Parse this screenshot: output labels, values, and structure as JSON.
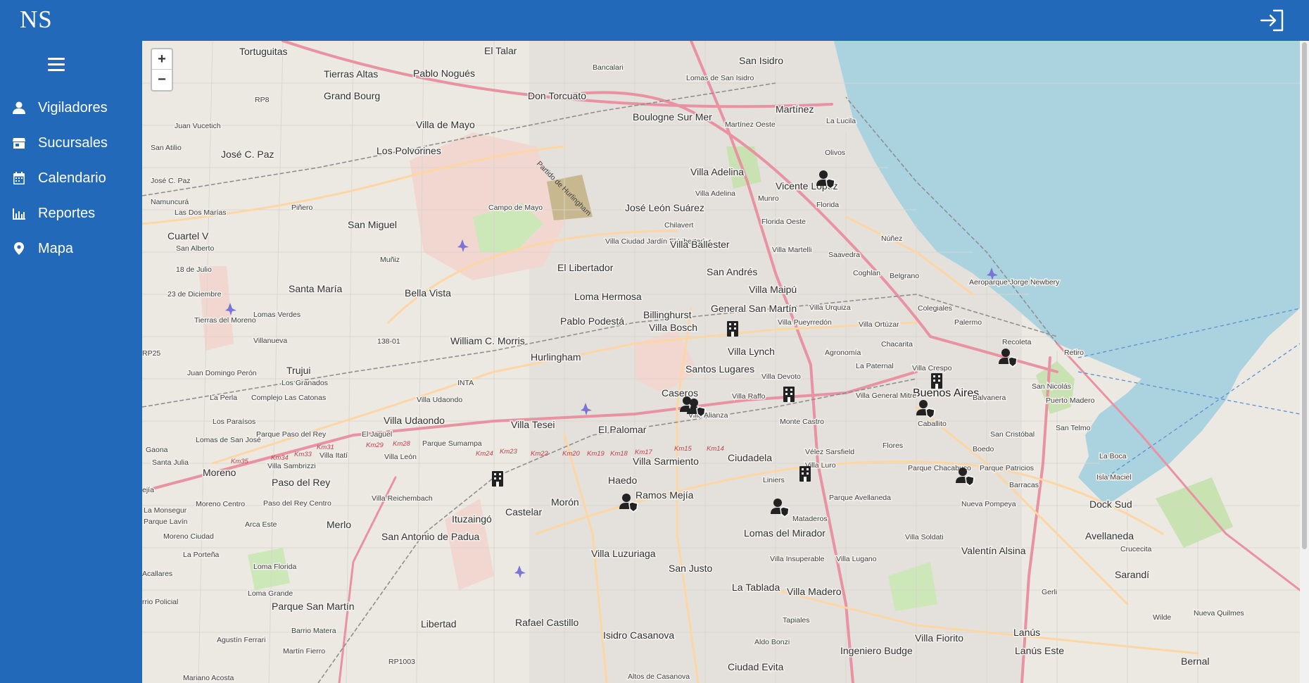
{
  "app": {
    "brand": "NS"
  },
  "nav": [
    {
      "label": "Vigiladores",
      "icon": "user-icon"
    },
    {
      "label": "Sucursales",
      "icon": "store-icon"
    },
    {
      "label": "Calendario",
      "icon": "calendar-icon"
    },
    {
      "label": "Reportes",
      "icon": "bar-chart-icon"
    },
    {
      "label": "Mapa",
      "icon": "map-pin-icon"
    }
  ],
  "map": {
    "zoom_in": "+",
    "zoom_out": "−",
    "labels": {
      "tortuguitas": "Tortuguitas",
      "el_talar": "El Talar",
      "san_isidro": "San Isidro",
      "bancalari": "Bancalari",
      "tierras_altas": "Tierras Altas",
      "pablo_nogues": "Pablo Nogués",
      "lomas_de_san_isidro": "Lomas de San Isidro",
      "rp8": "RP8",
      "grand_bourg": "Grand Bourg",
      "don_torcuato": "Don Torcuato",
      "martinez": "Martínez",
      "la_lucila": "La Lucila",
      "juan_vucetich": "Juan Vucetich",
      "villa_de_mayo": "Villa de Mayo",
      "boulogne": "Boulogne Sur Mer",
      "martinez_oeste": "Martínez Oeste",
      "san_atilio": "San Atilio",
      "jose_c_paz": "José C. Paz",
      "los_polvorines": "Los Polvorines",
      "olivos": "Olivos",
      "jose_c_paz_2": "José C. Paz",
      "villa_adelina": "Villa Adelina",
      "vicente_lopez": "Vicente López",
      "villa_adelina_2": "Villa Adelina",
      "munro": "Munro",
      "florida": "Florida",
      "namuncura": "Namuncurá",
      "las_dos_marias": "Las Dos Marías",
      "pinero": "Piñero",
      "campo_de_mayo": "Campo de Mayo",
      "jose_leon_suarez": "José León Suárez",
      "florida_oeste": "Florida Oeste",
      "san_miguel": "San Miguel",
      "chilavert": "Chilavert",
      "cuartel_v": "Cuartel V",
      "nunez": "Núñez",
      "san_alberto": "San Alberto",
      "villa_ciudad_jardin": "Villa Ciudad Jardín El Libertador",
      "villa_ballester": "Villa Ballester",
      "villa_martelli": "Villa Martelli",
      "saavedra": "Saavedra",
      "muniz": "Muñiz",
      "18_de_julio": "18 de Julio",
      "el_libertador": "El Libertador",
      "san_andres": "San Andrés",
      "coghlan": "Coghlan",
      "belgrano": "Belgrano",
      "aeroparque": "Aeroparque Jorge Newbery",
      "23_de_diciembre": "23 de Diciembre",
      "santa_maria": "Santa María",
      "bella_vista": "Bella Vista",
      "loma_hermosa": "Loma Hermosa",
      "villa_maipu": "Villa Maipú",
      "tierras_moreno": "Tierras del Moreno",
      "general_san_martin": "General San Martín",
      "villa_urquiza": "Villa Urquiza",
      "lomas_verdes": "Lomas Verdes",
      "billinghurst": "Billinghurst",
      "villa_ortuzar": "Villa Ortúzar",
      "colegiales": "Colegiales",
      "pablo_podesta": "Pablo Podestá",
      "villa_bosch": "Villa Bosch",
      "villa_pueyrredon": "Villa Pueyrredón",
      "palermo": "Palermo",
      "villanueva": "Villanueva",
      "r138": "138-01",
      "william_morris": "William C. Morris",
      "recoleta": "Recoleta",
      "rp25": "RP25",
      "hurlingham": "Hurlingham",
      "villa_lynch": "Villa Lynch",
      "agronomia": "Agronomía",
      "chacarita": "Chacarita",
      "retiro": "Retiro",
      "trujui": "Trujui",
      "juan_domingo_peron": "Juan Domingo Perón",
      "santos_lugares": "Santos Lugares",
      "la_paternal": "La Paternal",
      "villa_crespo": "Villa Crespo",
      "los_granados": "Los Granados",
      "inta": "INTA",
      "villa_devoto": "Villa Devoto",
      "san_nicolas": "San Nicolás",
      "buenos_aires": "Buenos Aires",
      "la_perla": "La Perla",
      "complejo": "Complejo Las Catonas",
      "villa_udaondo": "Villa Udaondo",
      "caseros": "Caseros",
      "villa_raffo": "Villa Raffo",
      "villa_general_mitre": "Villa General Mitre",
      "balvanera": "Balvanera",
      "puerto_madero": "Puerto Madero",
      "los_paraisos": "Los Paraísos",
      "villa_udaondo_2": "Villa Udaondo",
      "villa_alianza": "Villa Alianza",
      "monte_castro": "Monte Castro",
      "caballito": "Caballito",
      "villa_tesei": "Villa Tesei",
      "el_jaguel": "El Jagüel",
      "parque_paso": "Parque Paso del Rey",
      "parque_sumampa": "Parque Sumampa",
      "el_palomar": "El Palomar",
      "san_telmo": "San Telmo",
      "san_cristobal": "San Cristóbal",
      "lomas_san_jose": "Lomas de San José",
      "gaona": "Gaona",
      "flores": "Flores",
      "boedo": "Boedo",
      "santa_julia": "Santa Julia",
      "villa_itati": "Villa Itatí",
      "villa_leon": "Villa León",
      "velez": "Vélez Sarsfield",
      "la_boca": "La Boca",
      "villa_sarmiento": "Villa Sarmiento",
      "ciudadela": "Ciudadela",
      "villa_sambrizzi": "Villa Sambrizzi",
      "moreno": "Moreno",
      "liniers": "Liniers",
      "villa_luro": "Villa Luro",
      "parque_chacabuco": "Parque Chacabuco",
      "parque_patricios": "Parque Patricios",
      "isla_maciel": "Isla Maciel",
      "paso_del_rey": "Paso del Rey",
      "haedo": "Haedo",
      "barracas": "Barracas",
      "villa_reichembach": "Villa Reichembach",
      "ramos_mejia": "Ramos Mejía",
      "ejia": "ejía",
      "parque_avellaneda": "Parque Avellaneda",
      "nueva_pompeya": "Nueva Pompeya",
      "dock_sud": "Dock Sud",
      "la_monsegur": "La Monsegur",
      "moreno_centro": "Moreno Centro",
      "paso_del_rey_centro": "Paso del Rey Centro",
      "moron": "Morón",
      "castelar": "Castelar",
      "mataderos": "Mataderos",
      "parque_lavin": "Parque Lavín",
      "arca_este": "Arca Este",
      "ituzaingo": "Ituzaingó",
      "moreno_ciudad": "Moreno Ciudad",
      "merlo": "Merlo",
      "san_antonio_padua": "San Antonio de Padua",
      "lomas_del_mirador": "Lomas del Mirador",
      "villa_soldati": "Villa Soldati",
      "avellaneda": "Avellaneda",
      "crucecita": "Crucecita",
      "la_porteña": "La Porteña",
      "villa_luzuriaga": "Villa Luzuriaga",
      "villa_insuperable": "Villa Insuperable",
      "villa_lugano": "Villa Lugano",
      "valentin_alsina": "Valentín Alsina",
      "loma_florida": "Loma Florida",
      "san_justo": "San Justo",
      "sarandi": "Sarandí",
      "acallares": "Acallares",
      "loma_grande": "Loma Grande",
      "la_tablada": "La Tablada",
      "villa_madero": "Villa Madero",
      "gerli": "Gerli",
      "parque_san_martin": "Parque San Martín",
      "rrio_policial": "rrio Policial",
      "wilde": "Wilde",
      "libertad": "Libertad",
      "rafael_castillo": "Rafael Castillo",
      "tapiales": "Tapiales",
      "barrio_matera": "Barrio Matera",
      "isidro_casanova": "Isidro Casanova",
      "villa_fiorito": "Villa Fiorito",
      "lanus": "Lanús",
      "nueva_quilmes": "Nueva Quilmes",
      "agustin_ferrari": "Agustín Ferrari",
      "aldo_bonzi": "Aldo Bonzi",
      "ingeniero_budge": "Ingeniero Budge",
      "lanus_este": "Lanús Este",
      "martin_fierro": "Martín Fierro",
      "rp1003": "RP1003",
      "ciudad_evita": "Ciudad Evita",
      "bernal": "Bernal",
      "mariano_acosta": "Mariano Acosta",
      "altos_casanova": "Altos de Casanova",
      "km31": "Km31",
      "km29": "Km29",
      "km28": "Km28",
      "km35": "Km35",
      "km34": "Km34",
      "km33": "Km33",
      "km24": "Km24",
      "km23": "Km23",
      "km22": "Km22",
      "km20": "Km20",
      "km19": "Km19",
      "km18": "Km18",
      "km17": "Km17",
      "km15": "Km15",
      "km14": "Km14",
      "partido": "Partido de Hurlingham"
    }
  }
}
